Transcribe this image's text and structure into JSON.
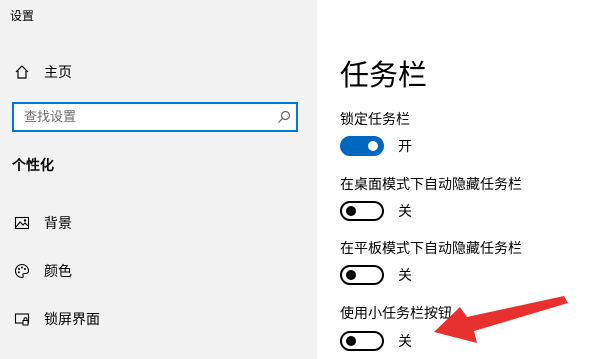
{
  "window": {
    "title": "设置"
  },
  "sidebar": {
    "home_label": "主页",
    "search_placeholder": "查找设置",
    "section_title": "个性化",
    "items": [
      {
        "label": "背景",
        "icon": "image-icon"
      },
      {
        "label": "颜色",
        "icon": "palette-icon"
      },
      {
        "label": "锁屏界面",
        "icon": "lock-screen-icon"
      }
    ]
  },
  "main": {
    "title": "任务栏",
    "settings": [
      {
        "label": "锁定任务栏",
        "state": "开",
        "on": true
      },
      {
        "label": "在桌面模式下自动隐藏任务栏",
        "state": "关",
        "on": false
      },
      {
        "label": "在平板模式下自动隐藏任务栏",
        "state": "关",
        "on": false
      },
      {
        "label": "使用小任务栏按钮",
        "state": "关",
        "on": false
      }
    ]
  },
  "colors": {
    "accent": "#0078d7",
    "toggle_on": "#0067c0",
    "sidebar_bg": "#f2f2f2",
    "annotation_arrow": "#e8312f"
  }
}
